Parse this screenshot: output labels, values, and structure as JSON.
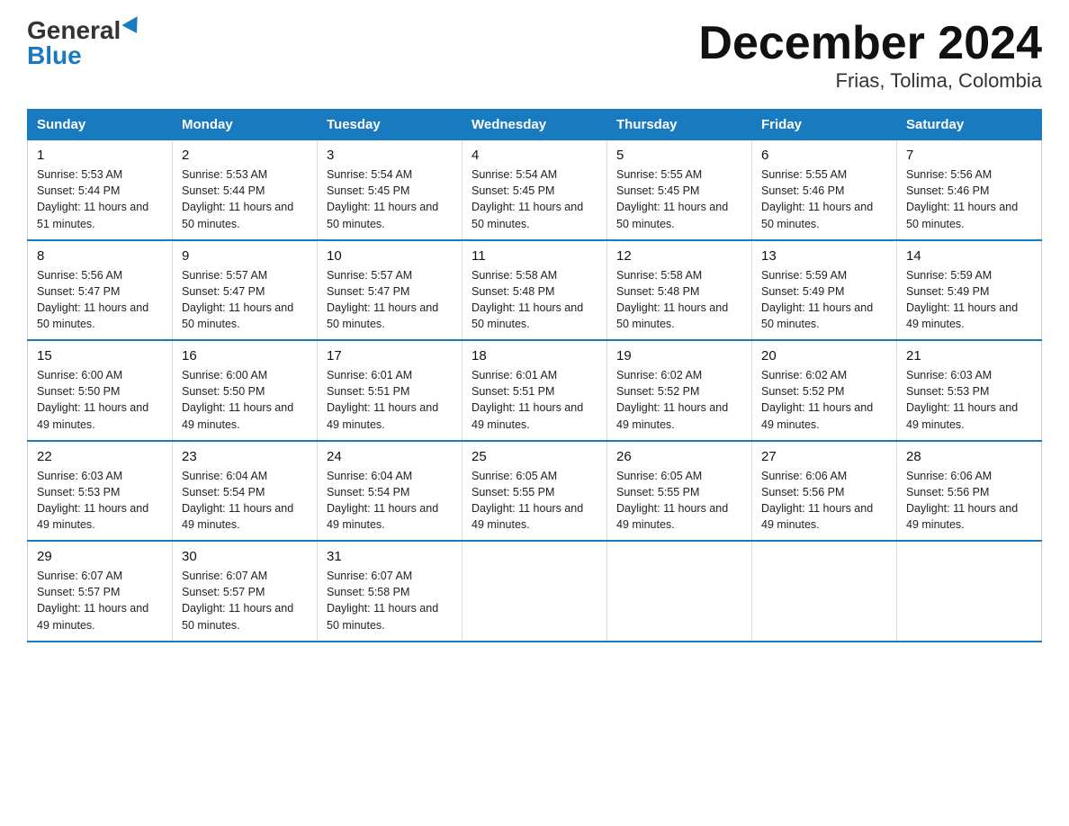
{
  "logo": {
    "general": "General",
    "blue": "Blue"
  },
  "title": "December 2024",
  "subtitle": "Frias, Tolima, Colombia",
  "weekdays": [
    "Sunday",
    "Monday",
    "Tuesday",
    "Wednesday",
    "Thursday",
    "Friday",
    "Saturday"
  ],
  "weeks": [
    [
      {
        "day": "1",
        "sunrise": "5:53 AM",
        "sunset": "5:44 PM",
        "daylight": "11 hours and 51 minutes."
      },
      {
        "day": "2",
        "sunrise": "5:53 AM",
        "sunset": "5:44 PM",
        "daylight": "11 hours and 50 minutes."
      },
      {
        "day": "3",
        "sunrise": "5:54 AM",
        "sunset": "5:45 PM",
        "daylight": "11 hours and 50 minutes."
      },
      {
        "day": "4",
        "sunrise": "5:54 AM",
        "sunset": "5:45 PM",
        "daylight": "11 hours and 50 minutes."
      },
      {
        "day": "5",
        "sunrise": "5:55 AM",
        "sunset": "5:45 PM",
        "daylight": "11 hours and 50 minutes."
      },
      {
        "day": "6",
        "sunrise": "5:55 AM",
        "sunset": "5:46 PM",
        "daylight": "11 hours and 50 minutes."
      },
      {
        "day": "7",
        "sunrise": "5:56 AM",
        "sunset": "5:46 PM",
        "daylight": "11 hours and 50 minutes."
      }
    ],
    [
      {
        "day": "8",
        "sunrise": "5:56 AM",
        "sunset": "5:47 PM",
        "daylight": "11 hours and 50 minutes."
      },
      {
        "day": "9",
        "sunrise": "5:57 AM",
        "sunset": "5:47 PM",
        "daylight": "11 hours and 50 minutes."
      },
      {
        "day": "10",
        "sunrise": "5:57 AM",
        "sunset": "5:47 PM",
        "daylight": "11 hours and 50 minutes."
      },
      {
        "day": "11",
        "sunrise": "5:58 AM",
        "sunset": "5:48 PM",
        "daylight": "11 hours and 50 minutes."
      },
      {
        "day": "12",
        "sunrise": "5:58 AM",
        "sunset": "5:48 PM",
        "daylight": "11 hours and 50 minutes."
      },
      {
        "day": "13",
        "sunrise": "5:59 AM",
        "sunset": "5:49 PM",
        "daylight": "11 hours and 50 minutes."
      },
      {
        "day": "14",
        "sunrise": "5:59 AM",
        "sunset": "5:49 PM",
        "daylight": "11 hours and 49 minutes."
      }
    ],
    [
      {
        "day": "15",
        "sunrise": "6:00 AM",
        "sunset": "5:50 PM",
        "daylight": "11 hours and 49 minutes."
      },
      {
        "day": "16",
        "sunrise": "6:00 AM",
        "sunset": "5:50 PM",
        "daylight": "11 hours and 49 minutes."
      },
      {
        "day": "17",
        "sunrise": "6:01 AM",
        "sunset": "5:51 PM",
        "daylight": "11 hours and 49 minutes."
      },
      {
        "day": "18",
        "sunrise": "6:01 AM",
        "sunset": "5:51 PM",
        "daylight": "11 hours and 49 minutes."
      },
      {
        "day": "19",
        "sunrise": "6:02 AM",
        "sunset": "5:52 PM",
        "daylight": "11 hours and 49 minutes."
      },
      {
        "day": "20",
        "sunrise": "6:02 AM",
        "sunset": "5:52 PM",
        "daylight": "11 hours and 49 minutes."
      },
      {
        "day": "21",
        "sunrise": "6:03 AM",
        "sunset": "5:53 PM",
        "daylight": "11 hours and 49 minutes."
      }
    ],
    [
      {
        "day": "22",
        "sunrise": "6:03 AM",
        "sunset": "5:53 PM",
        "daylight": "11 hours and 49 minutes."
      },
      {
        "day": "23",
        "sunrise": "6:04 AM",
        "sunset": "5:54 PM",
        "daylight": "11 hours and 49 minutes."
      },
      {
        "day": "24",
        "sunrise": "6:04 AM",
        "sunset": "5:54 PM",
        "daylight": "11 hours and 49 minutes."
      },
      {
        "day": "25",
        "sunrise": "6:05 AM",
        "sunset": "5:55 PM",
        "daylight": "11 hours and 49 minutes."
      },
      {
        "day": "26",
        "sunrise": "6:05 AM",
        "sunset": "5:55 PM",
        "daylight": "11 hours and 49 minutes."
      },
      {
        "day": "27",
        "sunrise": "6:06 AM",
        "sunset": "5:56 PM",
        "daylight": "11 hours and 49 minutes."
      },
      {
        "day": "28",
        "sunrise": "6:06 AM",
        "sunset": "5:56 PM",
        "daylight": "11 hours and 49 minutes."
      }
    ],
    [
      {
        "day": "29",
        "sunrise": "6:07 AM",
        "sunset": "5:57 PM",
        "daylight": "11 hours and 49 minutes."
      },
      {
        "day": "30",
        "sunrise": "6:07 AM",
        "sunset": "5:57 PM",
        "daylight": "11 hours and 50 minutes."
      },
      {
        "day": "31",
        "sunrise": "6:07 AM",
        "sunset": "5:58 PM",
        "daylight": "11 hours and 50 minutes."
      },
      null,
      null,
      null,
      null
    ]
  ]
}
